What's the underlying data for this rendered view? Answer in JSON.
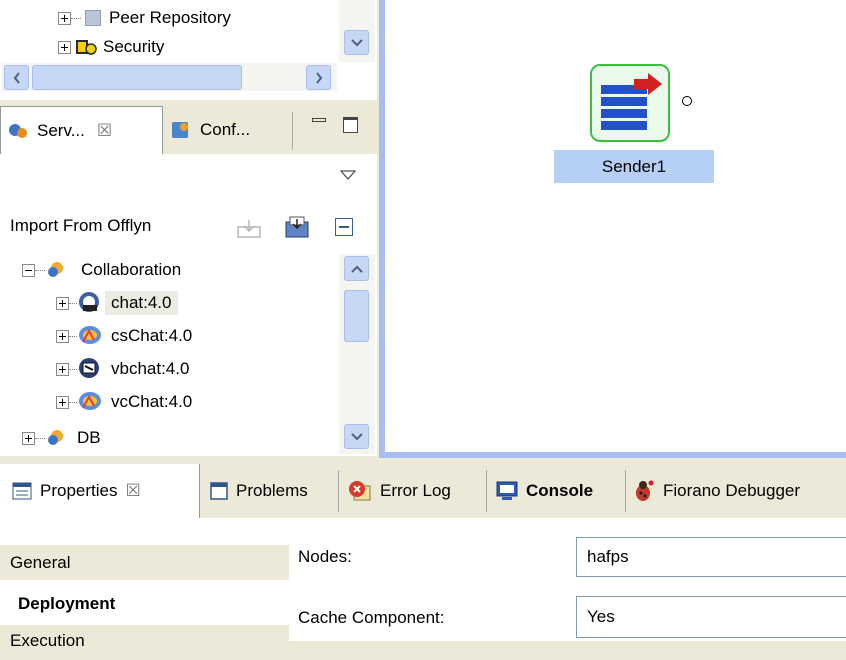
{
  "repo_tree": {
    "items": [
      {
        "label": "Peer Repository"
      },
      {
        "label": "Security"
      }
    ]
  },
  "views_panel": {
    "tabs": [
      {
        "label": "Serv..."
      },
      {
        "label": "Conf..."
      }
    ],
    "close_glyph": "☒",
    "import_label": "Import From Offlyn",
    "tree": {
      "groups": [
        {
          "label": "Collaboration"
        },
        {
          "label": "DB"
        }
      ],
      "items": [
        {
          "label": "chat:4.0"
        },
        {
          "label": "csChat:4.0"
        },
        {
          "label": "vbchat:4.0"
        },
        {
          "label": "vcChat:4.0"
        }
      ]
    }
  },
  "canvas": {
    "component_label": "Sender1"
  },
  "bottom_tabs": [
    {
      "label": "Properties"
    },
    {
      "label": "Problems"
    },
    {
      "label": "Error Log"
    },
    {
      "label": "Console"
    },
    {
      "label": "Fiorano Debugger"
    }
  ],
  "properties": {
    "sections": [
      {
        "label": "General"
      },
      {
        "label": "Deployment"
      },
      {
        "label": "Execution"
      }
    ],
    "fields": [
      {
        "label": "Nodes:",
        "value": "hafps"
      },
      {
        "label": "Cache Component:",
        "value": "Yes"
      }
    ]
  },
  "colors": {
    "selection": "#b6cff5",
    "canvas_border": "#a6bdf4",
    "component_border": "#3cbf3c",
    "component_fill": "#2450c8"
  }
}
